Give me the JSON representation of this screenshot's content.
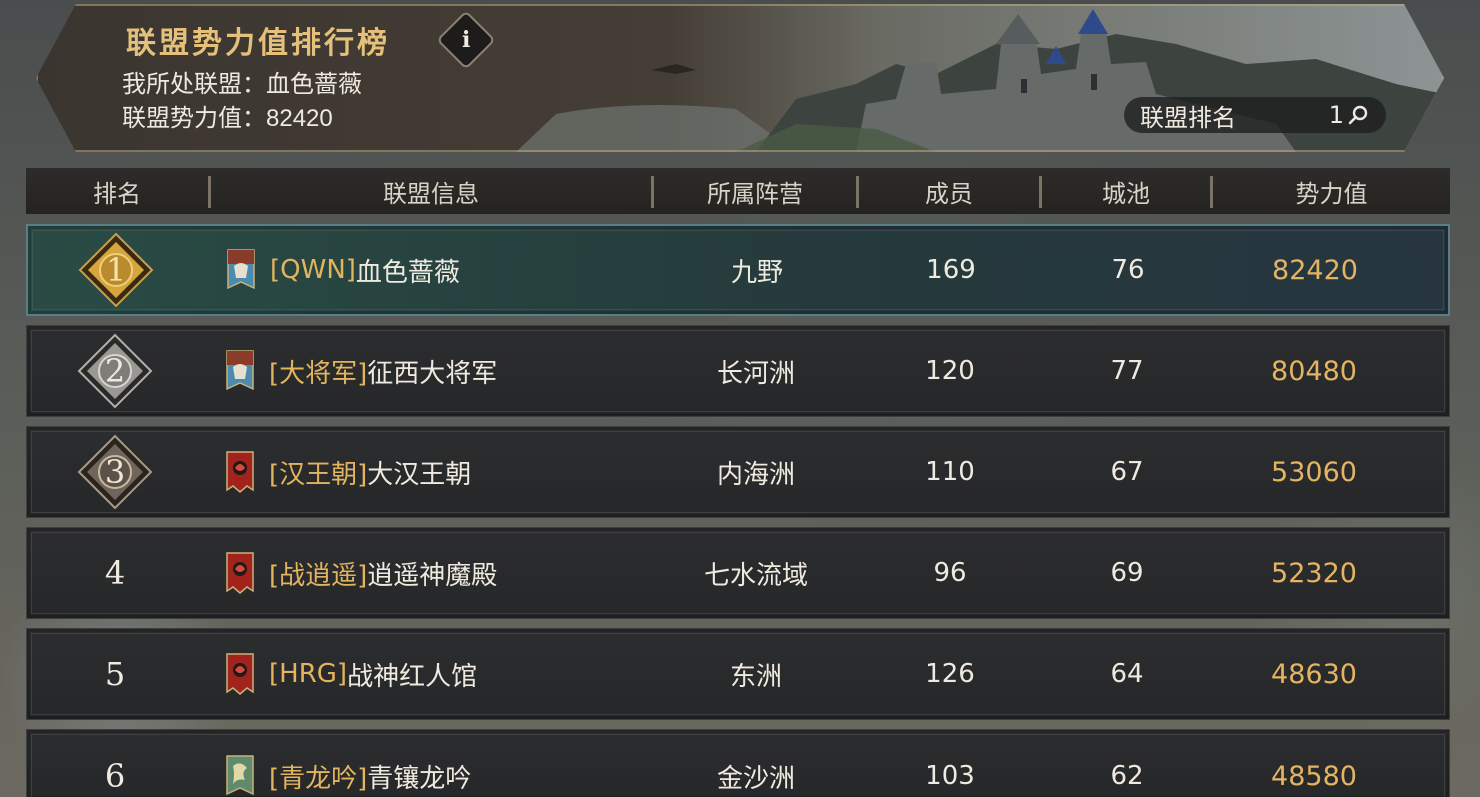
{
  "banner": {
    "title": "联盟势力值排行榜",
    "info_label": "i",
    "my_alliance_label": "我所处联盟：",
    "my_alliance_value": "血色蔷薇",
    "power_label": "联盟势力值：",
    "power_value": "82420",
    "rank_search_label": "联盟排名",
    "rank_search_value": "1"
  },
  "columns": [
    "排名",
    "联盟信息",
    "所属阵营",
    "成员",
    "城池",
    "势力值"
  ],
  "rows": [
    {
      "rank": "1",
      "tag": "[QWN]",
      "name": "血色蔷薇",
      "camp": "九野",
      "members": "169",
      "cities": "76",
      "power": "82420",
      "flag": "blue-banner-icon",
      "mine": true
    },
    {
      "rank": "2",
      "tag": "[大将军]",
      "name": "征西大将军",
      "camp": "长河洲",
      "members": "120",
      "cities": "77",
      "power": "80480",
      "flag": "blue-banner-icon",
      "mine": false
    },
    {
      "rank": "3",
      "tag": "[汉王朝]",
      "name": "大汉王朝",
      "camp": "内海洲",
      "members": "110",
      "cities": "67",
      "power": "53060",
      "flag": "red-banner-icon",
      "mine": false
    },
    {
      "rank": "4",
      "tag": "[战逍遥]",
      "name": "逍遥神魔殿",
      "camp": "七水流域",
      "members": "96",
      "cities": "69",
      "power": "52320",
      "flag": "red-banner-icon",
      "mine": false
    },
    {
      "rank": "5",
      "tag": "[HRG]",
      "name": "战神红人馆",
      "camp": "东洲",
      "members": "126",
      "cities": "64",
      "power": "48630",
      "flag": "red-banner-icon",
      "mine": false
    },
    {
      "rank": "6",
      "tag": "[青龙吟]",
      "name": "青镶龙吟",
      "camp": "金沙洲",
      "members": "103",
      "cities": "62",
      "power": "48580",
      "flag": "green-banner-icon",
      "mine": false
    }
  ],
  "colors": {
    "gold_accent": "#e4c07a",
    "power_text": "#e5b463",
    "tag_text": "#e2b45e",
    "highlight_row": "#274440"
  }
}
